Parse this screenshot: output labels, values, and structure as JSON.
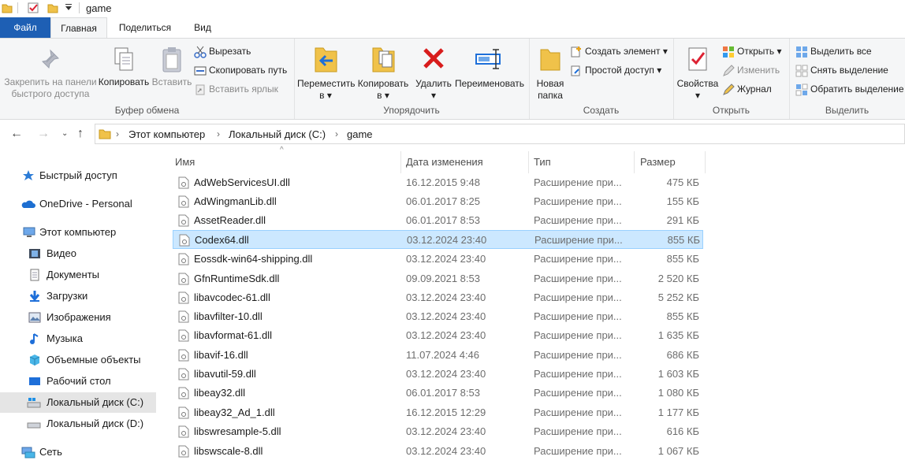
{
  "window": {
    "title": "game"
  },
  "menu_tabs": {
    "file": "Файл",
    "home": "Главная",
    "share": "Поделиться",
    "view": "Вид"
  },
  "ribbon": {
    "clipboard": {
      "label": "Буфер обмена",
      "pin_line1": "Закрепить на панели",
      "pin_line2": "быстрого доступа",
      "copy": "Копировать",
      "paste": "Вставить",
      "cut": "Вырезать",
      "copy_path": "Скопировать путь",
      "paste_shortcut": "Вставить ярлык"
    },
    "organize": {
      "label": "Упорядочить",
      "move_line1": "Переместить",
      "move_line2": "в",
      "copy_line1": "Копировать",
      "copy_line2": "в",
      "delete": "Удалить",
      "rename": "Переименовать"
    },
    "create": {
      "label": "Создать",
      "new_folder_line1": "Новая",
      "new_folder_line2": "папка",
      "new_item": "Создать элемент",
      "easy_access": "Простой доступ"
    },
    "open": {
      "label": "Открыть",
      "properties": "Свойства",
      "open": "Открыть",
      "edit": "Изменить",
      "history": "Журнал"
    },
    "select": {
      "label": "Выделить",
      "select_all": "Выделить все",
      "select_none": "Снять выделение",
      "invert": "Обратить выделение"
    }
  },
  "breadcrumb": [
    "Этот компьютер",
    "Локальный диск (C:)",
    "game"
  ],
  "sidebar": {
    "items": [
      {
        "label": "Быстрый доступ"
      },
      {
        "label": "OneDrive - Personal"
      },
      {
        "label": "Этот компьютер"
      },
      {
        "label": "Видео"
      },
      {
        "label": "Документы"
      },
      {
        "label": "Загрузки"
      },
      {
        "label": "Изображения"
      },
      {
        "label": "Музыка"
      },
      {
        "label": "Объемные объекты"
      },
      {
        "label": "Рабочий стол"
      },
      {
        "label": "Локальный диск (C:)"
      },
      {
        "label": "Локальный диск (D:)"
      },
      {
        "label": "Сеть"
      }
    ]
  },
  "columns": {
    "name": "Имя",
    "date": "Дата изменения",
    "type": "Тип",
    "size": "Размер"
  },
  "files": [
    {
      "name": "AdWebServicesUI.dll",
      "date": "16.12.2015 9:48",
      "type": "Расширение при...",
      "size": "475 КБ"
    },
    {
      "name": "AdWingmanLib.dll",
      "date": "06.01.2017 8:25",
      "type": "Расширение при...",
      "size": "155 КБ"
    },
    {
      "name": "AssetReader.dll",
      "date": "06.01.2017 8:53",
      "type": "Расширение при...",
      "size": "291 КБ"
    },
    {
      "name": "Codex64.dll",
      "date": "03.12.2024 23:40",
      "type": "Расширение при...",
      "size": "855 КБ"
    },
    {
      "name": "Eossdk-win64-shipping.dll",
      "date": "03.12.2024 23:40",
      "type": "Расширение при...",
      "size": "855 КБ"
    },
    {
      "name": "GfnRuntimeSdk.dll",
      "date": "09.09.2021 8:53",
      "type": "Расширение при...",
      "size": "2 520 КБ"
    },
    {
      "name": "libavcodec-61.dll",
      "date": "03.12.2024 23:40",
      "type": "Расширение при...",
      "size": "5 252 КБ"
    },
    {
      "name": "libavfilter-10.dll",
      "date": "03.12.2024 23:40",
      "type": "Расширение при...",
      "size": "855 КБ"
    },
    {
      "name": "libavformat-61.dll",
      "date": "03.12.2024 23:40",
      "type": "Расширение при...",
      "size": "1 635 КБ"
    },
    {
      "name": "libavif-16.dll",
      "date": "11.07.2024 4:46",
      "type": "Расширение при...",
      "size": "686 КБ"
    },
    {
      "name": "libavutil-59.dll",
      "date": "03.12.2024 23:40",
      "type": "Расширение при...",
      "size": "1 603 КБ"
    },
    {
      "name": "libeay32.dll",
      "date": "06.01.2017 8:53",
      "type": "Расширение при...",
      "size": "1 080 КБ"
    },
    {
      "name": "libeay32_Ad_1.dll",
      "date": "16.12.2015 12:29",
      "type": "Расширение при...",
      "size": "1 177 КБ"
    },
    {
      "name": "libswresample-5.dll",
      "date": "03.12.2024 23:40",
      "type": "Расширение при...",
      "size": "616 КБ"
    },
    {
      "name": "libswscale-8.dll",
      "date": "03.12.2024 23:40",
      "type": "Расширение при...",
      "size": "1 067 КБ"
    }
  ],
  "colors": {
    "accent": "#1e5fb4",
    "selection_bg": "#cce8ff",
    "selection_border": "#99d1ff"
  }
}
